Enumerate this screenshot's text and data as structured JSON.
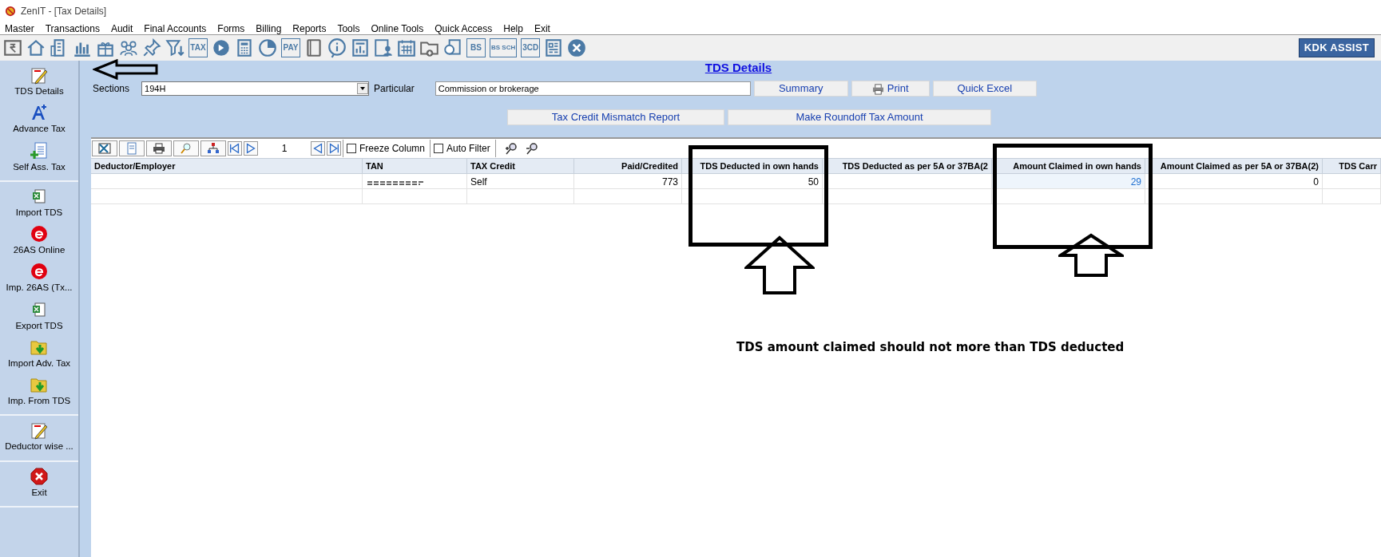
{
  "window": {
    "title": "ZenIT - [Tax Details]"
  },
  "menu": [
    "Master",
    "Transactions",
    "Audit",
    "Final Accounts",
    "Forms",
    "Billing",
    "Reports",
    "Tools",
    "Online Tools",
    "Quick Access",
    "Help",
    "Exit"
  ],
  "toolbar": [
    {
      "kind": "rupee"
    },
    {
      "kind": "home"
    },
    {
      "kind": "building"
    },
    {
      "kind": "chart"
    },
    {
      "kind": "gift"
    },
    {
      "kind": "people"
    },
    {
      "kind": "pin"
    },
    {
      "kind": "filter"
    },
    {
      "kind": "text",
      "label": "TAX"
    },
    {
      "kind": "disc"
    },
    {
      "kind": "calculator"
    },
    {
      "kind": "pie"
    },
    {
      "kind": "text",
      "label": "PAY"
    },
    {
      "kind": "book"
    },
    {
      "kind": "info"
    },
    {
      "kind": "report"
    },
    {
      "kind": "contact"
    },
    {
      "kind": "calendar"
    },
    {
      "kind": "folder"
    },
    {
      "kind": "doc"
    },
    {
      "kind": "text",
      "label": "BS"
    },
    {
      "kind": "text",
      "label": "BS SCH"
    },
    {
      "kind": "text",
      "label": "3CD"
    },
    {
      "kind": "grid"
    },
    {
      "kind": "close"
    }
  ],
  "assist_button": "KDK ASSIST",
  "sidebar": {
    "groups": [
      [
        {
          "kind": "tax",
          "label": "TDS Details"
        },
        {
          "kind": "aplus",
          "label": "Advance Tax"
        },
        {
          "kind": "docplus",
          "label": "Self Ass. Tax"
        }
      ],
      [
        {
          "kind": "excel",
          "label": "Import TDS"
        },
        {
          "kind": "e",
          "label": "26AS Online"
        },
        {
          "kind": "e",
          "label": "Imp. 26AS (Tx..."
        },
        {
          "kind": "excel",
          "label": "Export TDS"
        },
        {
          "kind": "folder",
          "label": "Import Adv. Tax"
        },
        {
          "kind": "folder",
          "label": "Imp. From TDS"
        }
      ],
      [
        {
          "kind": "tax",
          "label": "Deductor wise ..."
        }
      ],
      [
        {
          "kind": "exit",
          "label": "Exit"
        }
      ]
    ]
  },
  "form": {
    "title": "TDS Details",
    "sections_label": "Sections",
    "sections_value": "194H",
    "particular_label": "Particular",
    "particular_value": "Commission or brokerage",
    "buttons": [
      {
        "label": "Summary"
      },
      {
        "label": "Print"
      },
      {
        "label": "Quick Excel"
      }
    ],
    "buttons_row2": [
      "Tax Credit Mismatch Report",
      "Make Roundoff Tax Amount"
    ]
  },
  "grid": {
    "page": "1",
    "freeze_column": {
      "label": "Freeze Column",
      "checked": false
    },
    "auto_filter": {
      "label": "Auto Filter",
      "checked": false
    },
    "columns": [
      {
        "label": "Deductor/Employer"
      },
      {
        "label": "TAN"
      },
      {
        "label": "TAX Credit"
      },
      {
        "label": "Paid/Credited"
      },
      {
        "label": "TDS Deducted in own hands"
      },
      {
        "label": "TDS Deducted as per 5A or 37BA(2"
      },
      {
        "label": "Amount Claimed in own hands"
      },
      {
        "label": "Amount Claimed as per 5A or 37BA(2)"
      },
      {
        "label": "TDS Carr"
      }
    ],
    "rows": [
      {
        "cells": [
          {
            "text": null,
            "selected": false
          },
          {
            "text": null,
            "redacted": true,
            "selected": false
          },
          {
            "text": "Self",
            "selected": false
          },
          {
            "text": "773",
            "selected": false
          },
          {
            "text": "50",
            "selected": false
          },
          {
            "text": null,
            "selected": false
          },
          {
            "text": "29",
            "selected": true
          },
          {
            "text": "0",
            "selected": false
          },
          {
            "text": null,
            "selected": false
          }
        ]
      }
    ]
  },
  "annotations": {
    "note": "TDS amount claimed should not more than TDS deducted"
  }
}
